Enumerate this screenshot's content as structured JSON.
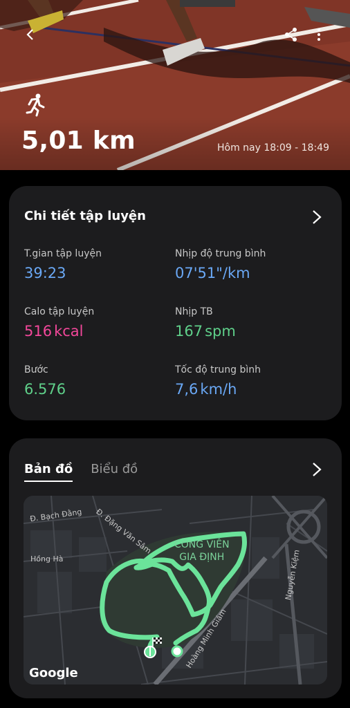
{
  "hero": {
    "activity_icon": "running-icon",
    "distance": "5,01 km",
    "time_range": "Hôm nay 18:09 - 18:49",
    "back_icon": "back-arrow-icon",
    "share_icon": "share-icon",
    "more_icon": "more-vertical-icon"
  },
  "details": {
    "title": "Chi tiết tập luyện",
    "stats": [
      {
        "label": "T.gian tập luyện",
        "value": "39:23",
        "unit": "",
        "color": "#6aa8f5"
      },
      {
        "label": "Nhịp độ trung bình",
        "value": "07'51\"/km",
        "unit": "",
        "color": "#6aa8f5"
      },
      {
        "label": "Calo tập luyện",
        "value": "516",
        "unit": "kcal",
        "color": "#f2479a"
      },
      {
        "label": "Nhịp TB",
        "value": "167",
        "unit": "spm",
        "color": "#5fd08a"
      },
      {
        "label": "Bước",
        "value": "6.576",
        "unit": "",
        "color": "#5fd08a"
      },
      {
        "label": "Tốc độ trung bình",
        "value": "7,6",
        "unit": "km/h",
        "color": "#6aa8f5"
      }
    ]
  },
  "map_card": {
    "tabs": [
      {
        "label": "Bản đồ",
        "active": true
      },
      {
        "label": "Biểu đồ",
        "active": false
      }
    ],
    "streets": {
      "bach_dang": "Đ. Bạch Đằng",
      "dang_van_sam": "Đ. Đặng Văn Sâm",
      "hong_ha": "Hồng Hà",
      "nguyen_kiem": "Nguyễn Kiệm",
      "hoang_minh_giam": "Hoàng Minh Giám"
    },
    "park_name": [
      "CÔNG VIÊN",
      "GIA ĐỊNH"
    ],
    "attribution": "Google",
    "route_color": "#6be39a"
  }
}
